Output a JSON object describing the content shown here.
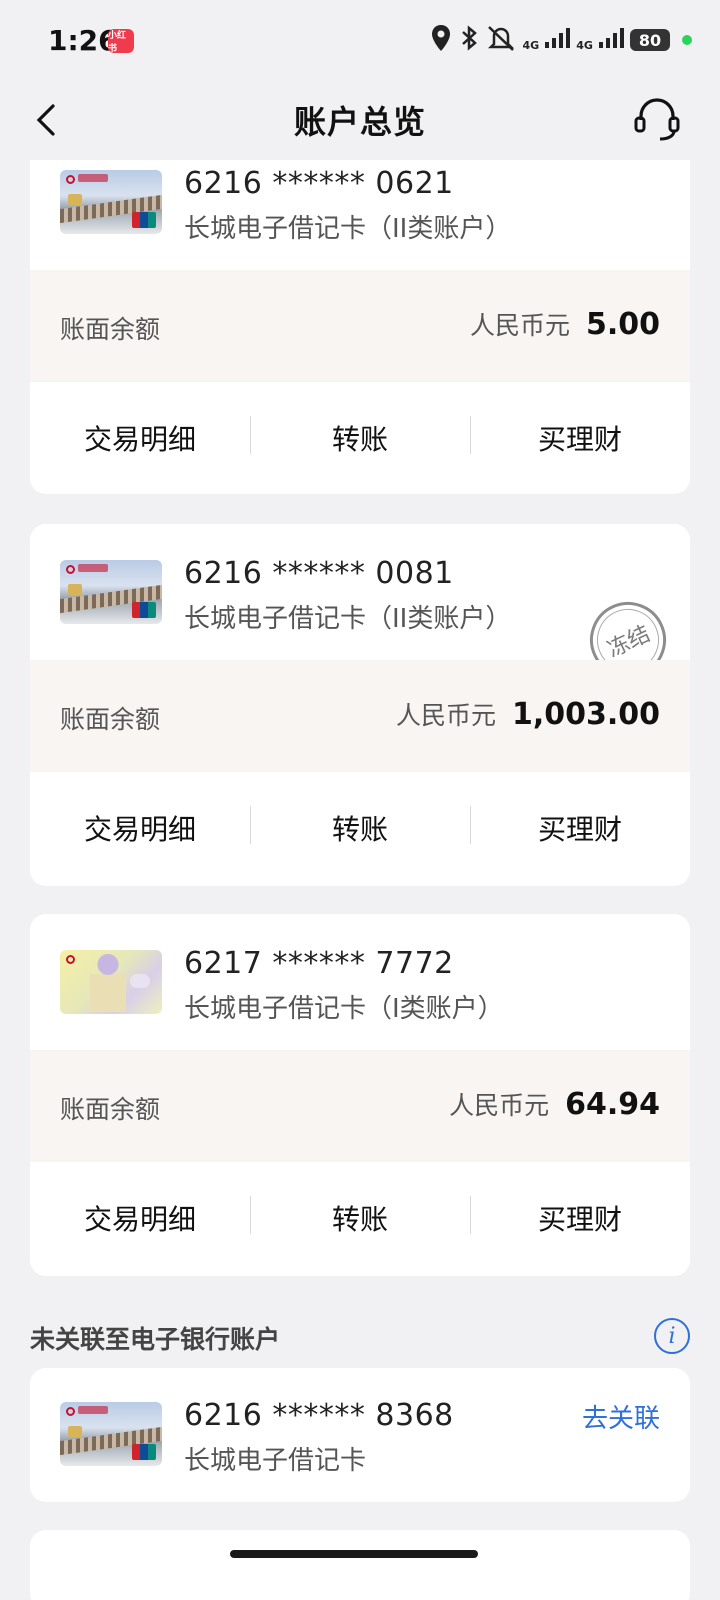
{
  "status_bar": {
    "time": "1:26",
    "app_badge": "小红书",
    "network1": "4G",
    "network2": "4G",
    "battery": "80"
  },
  "header": {
    "title": "账户总览"
  },
  "accounts": [
    {
      "number": "6216 ****** 0621",
      "type": "长城电子借记卡（II类账户）",
      "balance_label": "账面余额",
      "currency": "人民币元",
      "amount": "5.00",
      "actions": [
        "交易明细",
        "转账",
        "买理财"
      ]
    },
    {
      "number": "6216 ****** 0081",
      "type": "长城电子借记卡（II类账户）",
      "status_stamp": "冻结",
      "balance_label": "账面余额",
      "currency": "人民币元",
      "amount": "1,003.00",
      "actions": [
        "交易明细",
        "转账",
        "买理财"
      ]
    },
    {
      "number": "6217 ****** 7772",
      "type": "长城电子借记卡（I类账户）",
      "balance_label": "账面余额",
      "currency": "人民币元",
      "amount": "64.94",
      "actions": [
        "交易明细",
        "转账",
        "买理财"
      ]
    }
  ],
  "unlinked_section": {
    "title": "未关联至电子银行账户",
    "info_icon": "i",
    "card": {
      "number": "6216 ****** 8368",
      "type": "长城电子借记卡",
      "link_label": "去关联"
    }
  },
  "colors": {
    "accent_blue": "#2f6fd9",
    "balance_bg": "#f8f5f2",
    "page_bg": "#f1f1f3"
  }
}
